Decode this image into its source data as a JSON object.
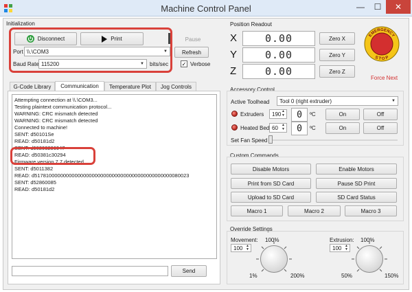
{
  "window": {
    "title": "Machine Control Panel",
    "minimize_glyph": "—",
    "maximize_glyph": "☐",
    "close_glyph": "✕"
  },
  "initialization": {
    "group_label": "Initialization",
    "connect_label": "Disconnect",
    "print_label": "Print",
    "pause_label": "Pause",
    "port_label": "Port",
    "port_value": "\\\\.\\COM3",
    "refresh_label": "Refresh",
    "baud_label": "Baud Rate",
    "baud_value": "115200",
    "baud_unit": "bits/sec",
    "verbose_label": "Verbose",
    "verbose_checked": true
  },
  "tabs": [
    "G-Code Library",
    "Communication",
    "Temperature Plot",
    "Jog Controls"
  ],
  "active_tab": "Communication",
  "log_lines": [
    "Attempting connection at \\\\.\\COM3...",
    "  Testing plaintext communication protocol...",
    "WARNING: CRC mismatch detected",
    "WARNING: CRC mismatch detected",
    "  Connected to machine!",
    "SENT: d50101Se",
    "READ: d50181d2",
    "SENT: d50203286047",
    "READ: d50381c30294",
    "  Firmware version 7.7 detected",
    "SENT: d5011382",
    "READ: d517810000000000000000000000000000000000000000000080023",
    "SENT: d52860085",
    "READ: d50181d2"
  ],
  "send_label": "Send",
  "command_value": "",
  "position": {
    "group_label": "Position Readout",
    "axes": [
      {
        "axis": "X",
        "value": "0.00",
        "zero_label": "Zero X"
      },
      {
        "axis": "Y",
        "value": "0.00",
        "zero_label": "Zero Y"
      },
      {
        "axis": "Z",
        "value": "0.00",
        "zero_label": "Zero Z"
      }
    ],
    "estop_text_top": "EMERGENCY",
    "estop_text_bottom": "STOP",
    "force_next_label": "Force Next"
  },
  "accessory": {
    "group_label": "Accessory Control",
    "active_toolhead_label": "Active Toolhead",
    "toolhead_value": "Tool 0 (right extruder)",
    "extruders_label": "Extruders",
    "extruder_target": "190",
    "extruder_current": "0",
    "heated_bed_label": "Heated Bed",
    "bed_target": "60",
    "bed_current": "0",
    "degree_unit": "ºC",
    "on_label": "On",
    "off_label": "Off",
    "fan_label": "Set Fan Speed",
    "colors": {
      "led": "#c62828",
      "estop": "#d32f2f",
      "estop_ring": "#f5c518"
    }
  },
  "custom": {
    "group_label": "Custom Commands",
    "buttons": [
      "Disable Motors",
      "Enable Motors",
      "Print from SD Card",
      "Pause SD Print",
      "Upload to SD Card",
      "SD Card Status",
      "Macro 1",
      "Macro 2",
      "Macro 3"
    ]
  },
  "override": {
    "group_label": "Override Settings",
    "movement_label": "Movement:",
    "movement_value": "100",
    "movement_top": "100%",
    "movement_min": "1%",
    "movement_max": "200%",
    "extrusion_label": "Extrusion:",
    "extrusion_value": "100",
    "extrusion_top": "100%",
    "extrusion_min": "50%",
    "extrusion_max": "150%"
  }
}
